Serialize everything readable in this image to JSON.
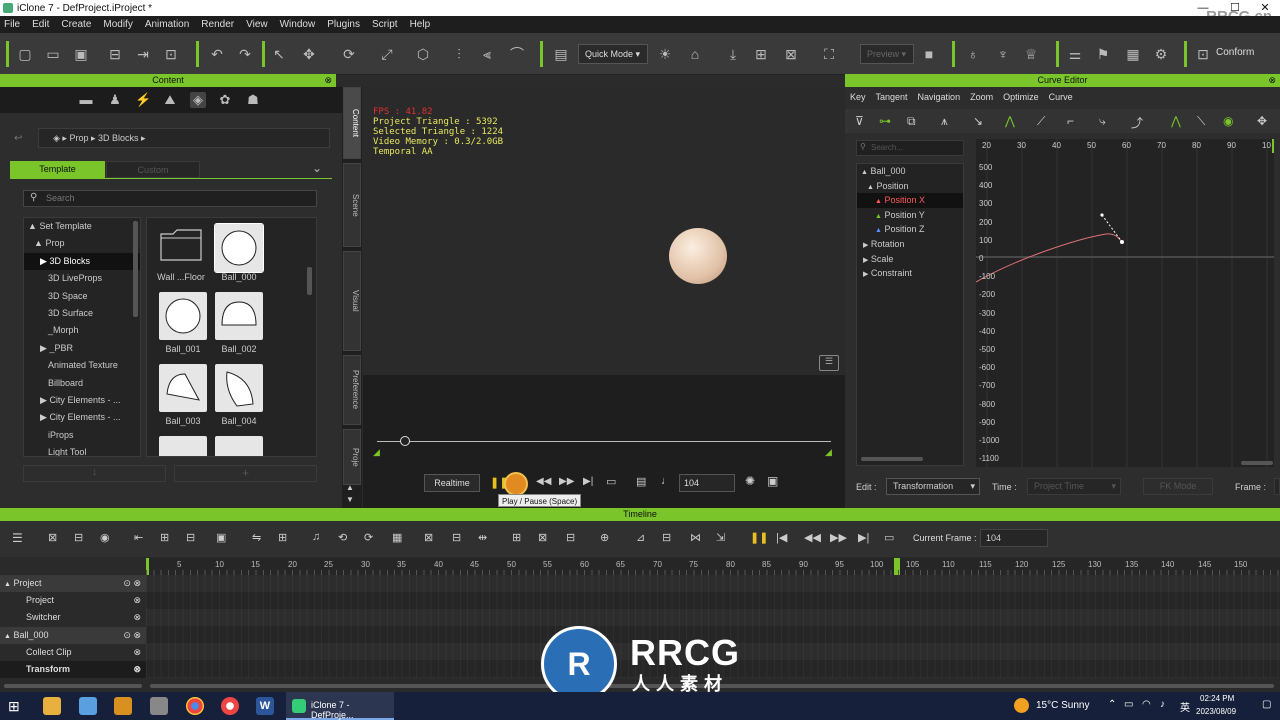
{
  "window": {
    "title": "iClone 7 - DefProject.iProject *",
    "minimize": "—",
    "maximize": "☐",
    "close": "✕"
  },
  "watermark_top": "RRCG.cn",
  "menu": [
    "File",
    "Edit",
    "Create",
    "Modify",
    "Animation",
    "Render",
    "View",
    "Window",
    "Plugins",
    "Script",
    "Help"
  ],
  "toolbar": {
    "mode": "Quick Mode",
    "preview": "Preview",
    "conform": "Conform"
  },
  "content_panel": {
    "title": "Content",
    "breadcrumb": [
      "Prop",
      "3D Blocks"
    ],
    "tabs": {
      "template": "Template",
      "custom": "Custom"
    },
    "search_placeholder": "Search",
    "tree": [
      {
        "label": "Set Template",
        "arrow": "▲"
      },
      {
        "label": "Prop",
        "arrow": "▲"
      },
      {
        "label": "3D Blocks",
        "arrow": "▶",
        "selected": true
      },
      {
        "label": "3D LiveProps",
        "arrow": ""
      },
      {
        "label": "3D Space",
        "arrow": ""
      },
      {
        "label": "3D Surface",
        "arrow": ""
      },
      {
        "label": "_Morph",
        "arrow": ""
      },
      {
        "label": "_PBR",
        "arrow": "▶"
      },
      {
        "label": "Animated Texture",
        "arrow": ""
      },
      {
        "label": "Billboard",
        "arrow": ""
      },
      {
        "label": "City Elements - ...",
        "arrow": "▶"
      },
      {
        "label": "City Elements - ...",
        "arrow": "▶"
      },
      {
        "label": "iProps",
        "arrow": ""
      },
      {
        "label": "Light Tool",
        "arrow": ""
      }
    ],
    "thumbs": [
      "Wall ...Floor",
      "Ball_000",
      "Ball_001",
      "Ball_002",
      "Ball_003",
      "Ball_004"
    ],
    "side_tabs": [
      "Content",
      "Scene",
      "Visual",
      "Preference",
      "Proje"
    ]
  },
  "viewport": {
    "stats": [
      "FPS : 41.82",
      "Project Triangle : 5392",
      "Selected Triangle : 1224",
      "Video Memory : 0.3/2.0GB",
      "Temporal AA"
    ],
    "realtime": "Realtime",
    "frame": "104",
    "tooltip": "Play / Pause (Space)"
  },
  "curve_editor": {
    "title": "Curve Editor",
    "menu": [
      "Key",
      "Tangent",
      "Navigation",
      "Zoom",
      "Optimize",
      "Curve"
    ],
    "search_placeholder": "Search...",
    "tree": [
      {
        "label": "Ball_000",
        "arrow": "▲"
      },
      {
        "label": "Position",
        "arrow": "▲"
      },
      {
        "label": "Position X",
        "arrow": "▲",
        "selected": true
      },
      {
        "label": "Position Y",
        "arrow": "▲"
      },
      {
        "label": "Position Z",
        "arrow": "▲"
      },
      {
        "label": "Rotation",
        "arrow": "▶"
      },
      {
        "label": "Scale",
        "arrow": "▶"
      },
      {
        "label": "Constraint",
        "arrow": "▶"
      }
    ],
    "xticks": [
      "20",
      "30",
      "40",
      "50",
      "60",
      "70",
      "80",
      "90",
      "10"
    ],
    "yticks": [
      "500",
      "400",
      "300",
      "200",
      "100",
      "0",
      "-100",
      "-200",
      "-300",
      "-400",
      "-500",
      "-600",
      "-700",
      "-800",
      "-900",
      "-1000",
      "-1100"
    ],
    "edit_label": "Edit :",
    "edit_value": "Transformation",
    "time_label": "Time :",
    "time_placeholder": "Project Time",
    "fk_mode": "FK Mode",
    "frame_label": "Frame :"
  },
  "timeline": {
    "title": "Timeline",
    "current_frame_label": "Current Frame :",
    "current_frame": "104",
    "ruler": [
      "5",
      "10",
      "15",
      "20",
      "25",
      "30",
      "35",
      "40",
      "45",
      "50",
      "55",
      "60",
      "65",
      "70",
      "75",
      "80",
      "85",
      "90",
      "95",
      "100",
      "105",
      "110",
      "115",
      "120",
      "125",
      "130",
      "135",
      "140",
      "145",
      "150"
    ],
    "tracks": [
      {
        "label": "Project",
        "group": true
      },
      {
        "label": "Project",
        "group": false
      },
      {
        "label": "Switcher",
        "group": false
      },
      {
        "label": "Ball_000",
        "group": true
      },
      {
        "label": "Collect Clip",
        "group": false
      },
      {
        "label": "Transform",
        "group": false
      }
    ]
  },
  "watermark_center": {
    "brand": "RRCG",
    "sub": "人人素材"
  },
  "taskbar": {
    "app": "iClone 7 - DefProje...",
    "weather": "15°C  Sunny",
    "time": "02:24 PM",
    "date": "2023/08/09"
  },
  "colors": {
    "accent": "#7ac52a",
    "selected_tree": "#ff5a5a"
  }
}
